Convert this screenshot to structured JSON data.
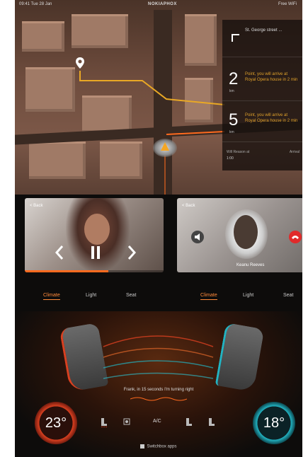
{
  "status": {
    "left": "09:41  Tue 28 Jan",
    "center": "NOKIAPHOX",
    "right": "Free WiFi"
  },
  "navigation": {
    "steps": [
      {
        "num": "",
        "unit": "",
        "text": "St. George street ..."
      },
      {
        "num": "2",
        "unit": "km",
        "text": "Point, you will arrive at Royal Opera house in 2 min"
      },
      {
        "num": "5",
        "unit": "km",
        "text": "Point, you will arrive at Royal Opera house in 2 min"
      }
    ],
    "footer_left": "Will Reason at",
    "footer_left_sub": "1:00",
    "footer_right": "Arrival"
  },
  "music": {
    "back_label": "< Back",
    "prev_icon": "chevron-left-icon",
    "pause_icon": "pause-icon",
    "next_icon": "chevron-right-icon",
    "progress": 0.6
  },
  "call": {
    "back_label": "< Back",
    "caller": "Keanu Reeves",
    "mute_icon": "speaker-icon",
    "hangup_icon": "phone-hangup-icon"
  },
  "tabs_left": [
    "Climate",
    "Light",
    "Seat"
  ],
  "tabs_right": [
    "Climate",
    "Light",
    "Seat"
  ],
  "climate": {
    "message": "Frank, in 15 seconds I'm turning right",
    "left_temp": "23°",
    "right_temp": "18°",
    "ac_label": "A/C",
    "apps_label": "Switchbox apps"
  },
  "colors": {
    "accent": "#ff6a1e",
    "warm": "#d94020",
    "cool": "#22b3c2"
  }
}
